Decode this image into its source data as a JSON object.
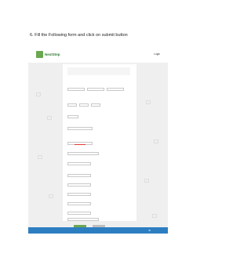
{
  "instruction": "6.  Fill the Following form and click on submit button",
  "site": {
    "logo_text": "NextStep",
    "login_label": "Login"
  },
  "colors": {
    "brand_green": "#6aa84f",
    "footer_blue": "#2d7ec1",
    "page_gray": "#efefef"
  }
}
